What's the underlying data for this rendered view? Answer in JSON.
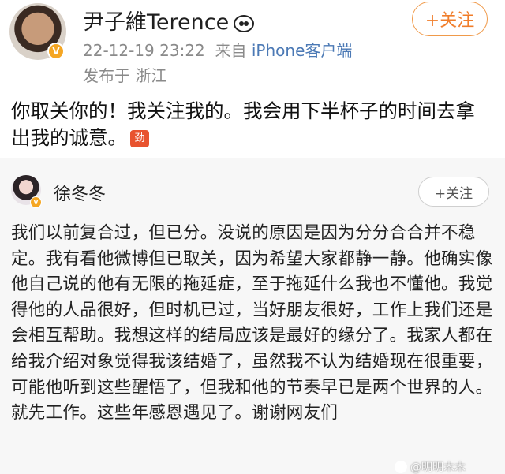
{
  "post1": {
    "username": "尹子維Terence",
    "username_emoji": "panda-icon",
    "timestamp": "22-12-19 23:22",
    "source_prefix": "来自",
    "source": "iPhone客户端",
    "location": "发布于 浙江",
    "follow_label": "+关注",
    "text": "你取关你的！我关注我的。我会用下半杯子的时间去拿出我的诚意。",
    "inline_emoji": "劲"
  },
  "post2": {
    "username": "徐冬冬",
    "follow_label": "+关注",
    "text": "我们以前复合过，但已分。没说的原因是因为分分合合并不稳定。我有看他微博但已取关，因为希望大家都静一静。他确实像他自己说的他有无限的拖延症，至于拖延什么我也不懂他。我觉得他的人品很好，但时机已过，当好朋友很好，工作上我们还是会相互帮助。我想这样的结局应该是最好的缘分了。我家人都在给我介绍对象觉得我该结婚了，虽然我不认为结婚现在很重要，可能他听到这些醒悟了，但我和他的节奏早已是两个世界的人。就先工作。这些年感恩遇见了。谢谢网友们"
  },
  "watermark": "@明明木木",
  "colors": {
    "accent_orange": "#f07d2a",
    "link_blue": "#4b79b5",
    "verified_badge": "#f5a623"
  }
}
